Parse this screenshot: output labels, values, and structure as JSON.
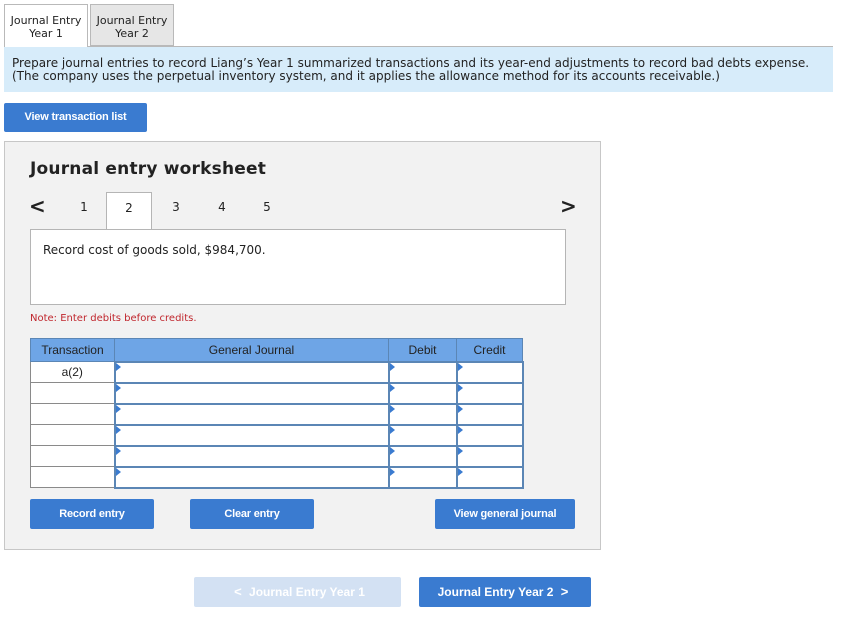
{
  "tabs": [
    {
      "line1": "Journal Entry",
      "line2": "Year 1"
    },
    {
      "line1": "Journal Entry",
      "line2": "Year 2"
    }
  ],
  "instructions": {
    "line1": "Prepare journal entries to record Liang’s Year 1 summarized transactions and its year-end adjustments to record bad debts expense.",
    "line2": "(The company uses the perpetual inventory system, and it applies the allowance method for its accounts receivable.)"
  },
  "view_transaction_list": "View transaction list",
  "worksheet": {
    "title": "Journal entry worksheet",
    "pager": {
      "prev_icon": "<",
      "next_icon": ">",
      "pages": [
        "1",
        "2",
        "3",
        "4",
        "5"
      ],
      "active_page": "2"
    },
    "description": "Record cost of goods sold, $984,700.",
    "note": "Note: Enter debits before credits.",
    "table": {
      "headers": {
        "transaction": "Transaction",
        "general_journal": "General Journal",
        "debit": "Debit",
        "credit": "Credit"
      },
      "rows": [
        {
          "transaction": "a(2)",
          "account": "",
          "debit": "",
          "credit": ""
        },
        {
          "transaction": "",
          "account": "",
          "debit": "",
          "credit": ""
        },
        {
          "transaction": "",
          "account": "",
          "debit": "",
          "credit": ""
        },
        {
          "transaction": "",
          "account": "",
          "debit": "",
          "credit": ""
        },
        {
          "transaction": "",
          "account": "",
          "debit": "",
          "credit": ""
        },
        {
          "transaction": "",
          "account": "",
          "debit": "",
          "credit": ""
        }
      ]
    },
    "buttons": {
      "record": "Record entry",
      "clear": "Clear entry",
      "view_general_journal": "View general journal"
    }
  },
  "footer_nav": {
    "prev_label": "Journal Entry Year 1",
    "next_label": "Journal Entry Year 2",
    "prev_icon": "<",
    "next_icon": ">"
  },
  "colors": {
    "accent": "#3a7bd0",
    "header_blue": "#6ea5e6",
    "instruction_bg": "#d7ecfa",
    "note_red": "#c0262d"
  }
}
